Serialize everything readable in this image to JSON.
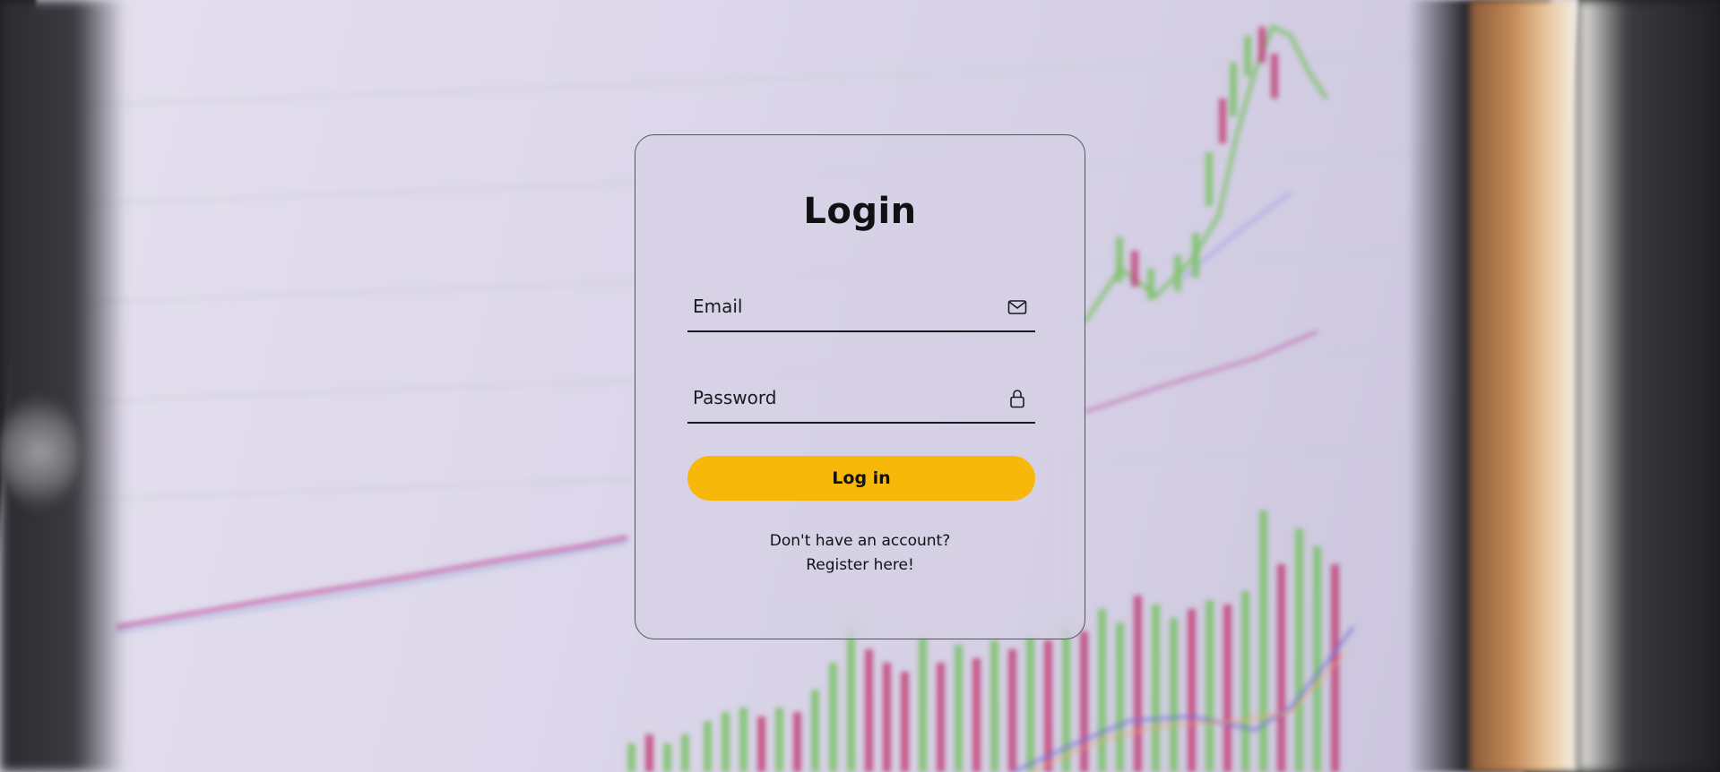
{
  "login": {
    "title": "Login",
    "email": {
      "placeholder": "Email",
      "icon": "envelope-icon"
    },
    "password": {
      "placeholder": "Password",
      "icon": "lock-icon"
    },
    "submit_label": "Log in",
    "register_prompt": "Don't have an account?",
    "register_link": "Register here!"
  },
  "colors": {
    "accent": "#f8b80a",
    "card_border": "#555560",
    "text": "#111114"
  }
}
